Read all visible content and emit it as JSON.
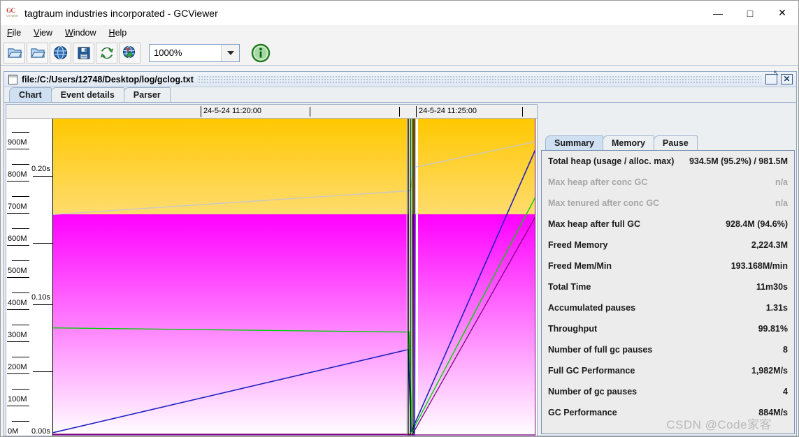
{
  "window": {
    "title": "tagtraum industries incorporated - GCViewer",
    "app_icon": "gcviewer-icon",
    "icon_text_top": "GC",
    "icon_text_bottom": "VIEWER",
    "minimize": "—",
    "maximize": "□",
    "close": "✕"
  },
  "menu": {
    "items": [
      {
        "label": "File",
        "mnemonic": "F"
      },
      {
        "label": "View",
        "mnemonic": "V"
      },
      {
        "label": "Window",
        "mnemonic": "W"
      },
      {
        "label": "Help",
        "mnemonic": "H"
      }
    ]
  },
  "toolbar": {
    "buttons": [
      {
        "name": "open-file-button",
        "icon": "open-folder-icon"
      },
      {
        "name": "open-recent-button",
        "icon": "open-folder-icon"
      },
      {
        "name": "open-url-button",
        "icon": "globe-icon"
      },
      {
        "name": "export-button",
        "icon": "floppy-save-icon"
      },
      {
        "name": "refresh-button",
        "icon": "refresh-arrows-icon"
      },
      {
        "name": "watch-button",
        "icon": "globe-clock-icon"
      }
    ],
    "zoom": {
      "value": "1000%",
      "placeholder": "100%"
    },
    "about_button": {
      "name": "about-button",
      "icon": "info-circle-icon"
    }
  },
  "document": {
    "path": "file:/C:/Users/12748/Desktop/log/gclog.txt",
    "restore_label": "❐",
    "close_label": "✕",
    "tabs": [
      {
        "label": "Chart",
        "active": true
      },
      {
        "label": "Event details",
        "active": false
      },
      {
        "label": "Parser",
        "active": false
      }
    ]
  },
  "chart_data": {
    "type": "area",
    "title": "",
    "xlabel": "",
    "ylabel": "",
    "y2label": "",
    "x_tick_labels": [
      "24-5-24 11:20:00",
      "24-5-24 11:25:00"
    ],
    "x_tick_marks_unlabeled": 2,
    "y_left_ticks": [
      "900M",
      "800M",
      "700M",
      "600M",
      "500M",
      "400M",
      "300M",
      "200M",
      "100M",
      "0M"
    ],
    "y_left_unit": "M",
    "y_left_range": [
      0,
      980
    ],
    "y_right_ticks": [
      "0.20s",
      "0.10s",
      "0.00s"
    ],
    "y_right_range": [
      0,
      0.22
    ],
    "series": [
      {
        "name": "tenured-heap-area",
        "color": "#ffc800",
        "kind": "area",
        "label": "Tenured generation"
      },
      {
        "name": "young-heap-area",
        "color": "#ff00ff",
        "kind": "area",
        "label": "Young generation"
      },
      {
        "name": "total-heap-line",
        "color": "#c0c0c0",
        "kind": "line",
        "label": "Total heap"
      },
      {
        "name": "used-heap-line",
        "color": "#2020c0",
        "kind": "line",
        "label": "Used heap"
      },
      {
        "name": "used-tenured-line",
        "color": "#00d000",
        "kind": "line",
        "label": "Used tenured heap"
      },
      {
        "name": "gc-times-line",
        "color": "#800080",
        "kind": "line",
        "label": "GC times"
      },
      {
        "name": "full-gc-lines",
        "color": "#000000",
        "kind": "vline",
        "label": "Full GC events"
      }
    ],
    "grid": false,
    "legend": "none",
    "zoom": "1000%"
  },
  "summary": {
    "tabs": [
      {
        "label": "Summary",
        "active": true
      },
      {
        "label": "Memory",
        "active": false
      },
      {
        "label": "Pause",
        "active": false
      }
    ],
    "rows": [
      {
        "label": "Total heap (usage / alloc. max)",
        "value": "934.5M (95.2%) / 981.5M",
        "dim": false
      },
      {
        "label": "Max heap after conc GC",
        "value": "n/a",
        "dim": true
      },
      {
        "label": "Max tenured after conc GC",
        "value": "n/a",
        "dim": true
      },
      {
        "label": "Max heap after full GC",
        "value": "928.4M (94.6%)",
        "dim": false
      },
      {
        "label": "Freed Memory",
        "value": "2,224.3M",
        "dim": false
      },
      {
        "label": "Freed Mem/Min",
        "value": "193.168M/min",
        "dim": false
      },
      {
        "label": "Total Time",
        "value": "11m30s",
        "dim": false
      },
      {
        "label": "Accumulated pauses",
        "value": "1.31s",
        "dim": false
      },
      {
        "label": "Throughput",
        "value": "99.81%",
        "dim": false
      },
      {
        "label": "Number of full gc pauses",
        "value": "8",
        "dim": false
      },
      {
        "label": "Full GC Performance",
        "value": "1,982M/s",
        "dim": false
      },
      {
        "label": "Number of gc pauses",
        "value": "4",
        "dim": false
      },
      {
        "label": "GC Performance",
        "value": "884M/s",
        "dim": false
      }
    ]
  },
  "watermark": {
    "text": "CSDN @Code家客"
  },
  "colors": {
    "tenured": "#ffc800",
    "young": "#ff00ff",
    "used_heap_line": "#2020c0",
    "used_tenured_line": "#00d000",
    "total_heap_line": "#c0c0c0",
    "gc_times_line": "#800080",
    "tab_active": "#cfe0f2",
    "frame_border": "#8ea7c4"
  }
}
